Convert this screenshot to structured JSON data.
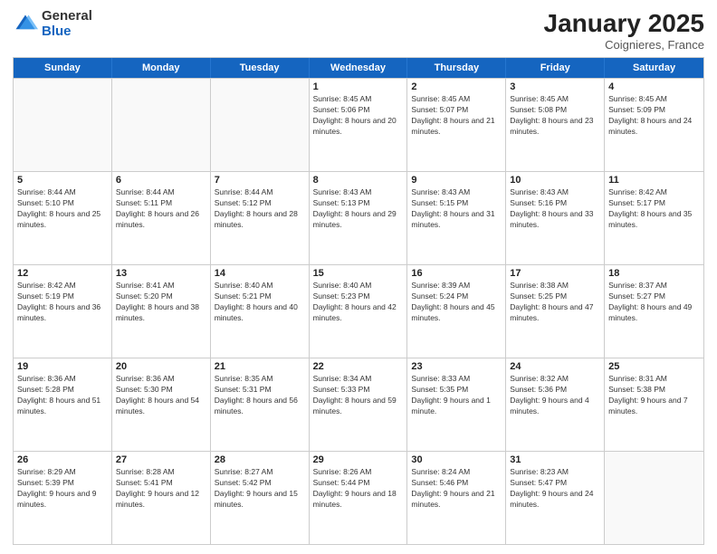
{
  "logo": {
    "general": "General",
    "blue": "Blue"
  },
  "header": {
    "month": "January 2025",
    "location": "Coignieres, France"
  },
  "weekdays": [
    "Sunday",
    "Monday",
    "Tuesday",
    "Wednesday",
    "Thursday",
    "Friday",
    "Saturday"
  ],
  "rows": [
    [
      {
        "day": "",
        "sunrise": "",
        "sunset": "",
        "daylight": ""
      },
      {
        "day": "",
        "sunrise": "",
        "sunset": "",
        "daylight": ""
      },
      {
        "day": "",
        "sunrise": "",
        "sunset": "",
        "daylight": ""
      },
      {
        "day": "1",
        "sunrise": "Sunrise: 8:45 AM",
        "sunset": "Sunset: 5:06 PM",
        "daylight": "Daylight: 8 hours and 20 minutes."
      },
      {
        "day": "2",
        "sunrise": "Sunrise: 8:45 AM",
        "sunset": "Sunset: 5:07 PM",
        "daylight": "Daylight: 8 hours and 21 minutes."
      },
      {
        "day": "3",
        "sunrise": "Sunrise: 8:45 AM",
        "sunset": "Sunset: 5:08 PM",
        "daylight": "Daylight: 8 hours and 23 minutes."
      },
      {
        "day": "4",
        "sunrise": "Sunrise: 8:45 AM",
        "sunset": "Sunset: 5:09 PM",
        "daylight": "Daylight: 8 hours and 24 minutes."
      }
    ],
    [
      {
        "day": "5",
        "sunrise": "Sunrise: 8:44 AM",
        "sunset": "Sunset: 5:10 PM",
        "daylight": "Daylight: 8 hours and 25 minutes."
      },
      {
        "day": "6",
        "sunrise": "Sunrise: 8:44 AM",
        "sunset": "Sunset: 5:11 PM",
        "daylight": "Daylight: 8 hours and 26 minutes."
      },
      {
        "day": "7",
        "sunrise": "Sunrise: 8:44 AM",
        "sunset": "Sunset: 5:12 PM",
        "daylight": "Daylight: 8 hours and 28 minutes."
      },
      {
        "day": "8",
        "sunrise": "Sunrise: 8:43 AM",
        "sunset": "Sunset: 5:13 PM",
        "daylight": "Daylight: 8 hours and 29 minutes."
      },
      {
        "day": "9",
        "sunrise": "Sunrise: 8:43 AM",
        "sunset": "Sunset: 5:15 PM",
        "daylight": "Daylight: 8 hours and 31 minutes."
      },
      {
        "day": "10",
        "sunrise": "Sunrise: 8:43 AM",
        "sunset": "Sunset: 5:16 PM",
        "daylight": "Daylight: 8 hours and 33 minutes."
      },
      {
        "day": "11",
        "sunrise": "Sunrise: 8:42 AM",
        "sunset": "Sunset: 5:17 PM",
        "daylight": "Daylight: 8 hours and 35 minutes."
      }
    ],
    [
      {
        "day": "12",
        "sunrise": "Sunrise: 8:42 AM",
        "sunset": "Sunset: 5:19 PM",
        "daylight": "Daylight: 8 hours and 36 minutes."
      },
      {
        "day": "13",
        "sunrise": "Sunrise: 8:41 AM",
        "sunset": "Sunset: 5:20 PM",
        "daylight": "Daylight: 8 hours and 38 minutes."
      },
      {
        "day": "14",
        "sunrise": "Sunrise: 8:40 AM",
        "sunset": "Sunset: 5:21 PM",
        "daylight": "Daylight: 8 hours and 40 minutes."
      },
      {
        "day": "15",
        "sunrise": "Sunrise: 8:40 AM",
        "sunset": "Sunset: 5:23 PM",
        "daylight": "Daylight: 8 hours and 42 minutes."
      },
      {
        "day": "16",
        "sunrise": "Sunrise: 8:39 AM",
        "sunset": "Sunset: 5:24 PM",
        "daylight": "Daylight: 8 hours and 45 minutes."
      },
      {
        "day": "17",
        "sunrise": "Sunrise: 8:38 AM",
        "sunset": "Sunset: 5:25 PM",
        "daylight": "Daylight: 8 hours and 47 minutes."
      },
      {
        "day": "18",
        "sunrise": "Sunrise: 8:37 AM",
        "sunset": "Sunset: 5:27 PM",
        "daylight": "Daylight: 8 hours and 49 minutes."
      }
    ],
    [
      {
        "day": "19",
        "sunrise": "Sunrise: 8:36 AM",
        "sunset": "Sunset: 5:28 PM",
        "daylight": "Daylight: 8 hours and 51 minutes."
      },
      {
        "day": "20",
        "sunrise": "Sunrise: 8:36 AM",
        "sunset": "Sunset: 5:30 PM",
        "daylight": "Daylight: 8 hours and 54 minutes."
      },
      {
        "day": "21",
        "sunrise": "Sunrise: 8:35 AM",
        "sunset": "Sunset: 5:31 PM",
        "daylight": "Daylight: 8 hours and 56 minutes."
      },
      {
        "day": "22",
        "sunrise": "Sunrise: 8:34 AM",
        "sunset": "Sunset: 5:33 PM",
        "daylight": "Daylight: 8 hours and 59 minutes."
      },
      {
        "day": "23",
        "sunrise": "Sunrise: 8:33 AM",
        "sunset": "Sunset: 5:35 PM",
        "daylight": "Daylight: 9 hours and 1 minute."
      },
      {
        "day": "24",
        "sunrise": "Sunrise: 8:32 AM",
        "sunset": "Sunset: 5:36 PM",
        "daylight": "Daylight: 9 hours and 4 minutes."
      },
      {
        "day": "25",
        "sunrise": "Sunrise: 8:31 AM",
        "sunset": "Sunset: 5:38 PM",
        "daylight": "Daylight: 9 hours and 7 minutes."
      }
    ],
    [
      {
        "day": "26",
        "sunrise": "Sunrise: 8:29 AM",
        "sunset": "Sunset: 5:39 PM",
        "daylight": "Daylight: 9 hours and 9 minutes."
      },
      {
        "day": "27",
        "sunrise": "Sunrise: 8:28 AM",
        "sunset": "Sunset: 5:41 PM",
        "daylight": "Daylight: 9 hours and 12 minutes."
      },
      {
        "day": "28",
        "sunrise": "Sunrise: 8:27 AM",
        "sunset": "Sunset: 5:42 PM",
        "daylight": "Daylight: 9 hours and 15 minutes."
      },
      {
        "day": "29",
        "sunrise": "Sunrise: 8:26 AM",
        "sunset": "Sunset: 5:44 PM",
        "daylight": "Daylight: 9 hours and 18 minutes."
      },
      {
        "day": "30",
        "sunrise": "Sunrise: 8:24 AM",
        "sunset": "Sunset: 5:46 PM",
        "daylight": "Daylight: 9 hours and 21 minutes."
      },
      {
        "day": "31",
        "sunrise": "Sunrise: 8:23 AM",
        "sunset": "Sunset: 5:47 PM",
        "daylight": "Daylight: 9 hours and 24 minutes."
      },
      {
        "day": "",
        "sunrise": "",
        "sunset": "",
        "daylight": ""
      }
    ]
  ]
}
